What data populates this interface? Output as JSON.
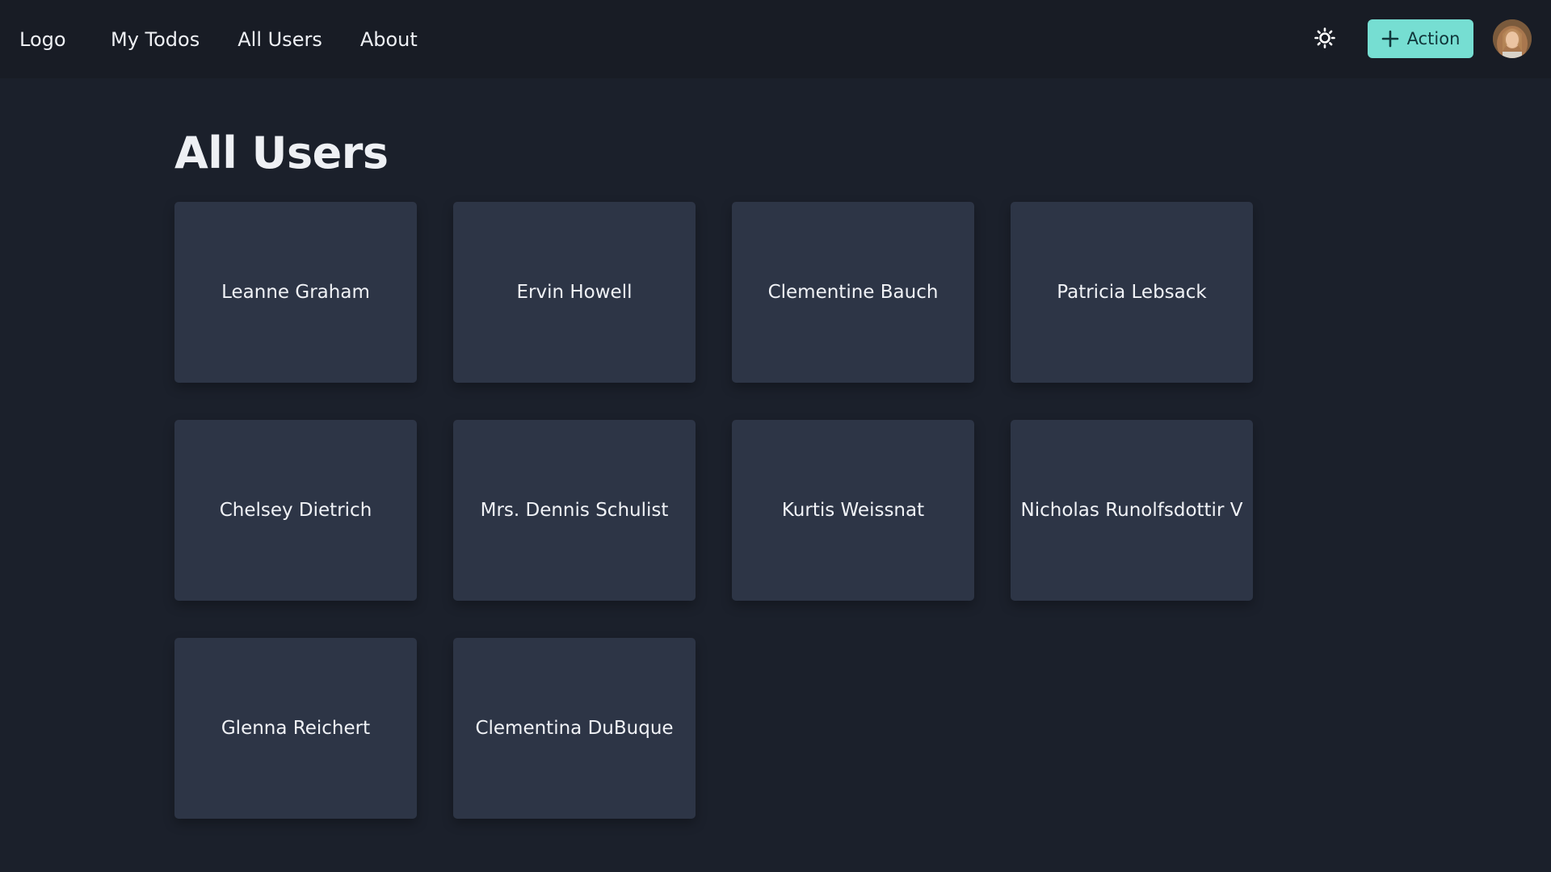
{
  "nav": {
    "logo": "Logo",
    "links": [
      {
        "label": "My Todos"
      },
      {
        "label": "All Users"
      },
      {
        "label": "About"
      }
    ],
    "theme_icon": "sun-icon",
    "action_label": "Action",
    "action_icon": "plus-icon",
    "avatar_icon": "user-avatar"
  },
  "page": {
    "title": "All Users"
  },
  "users": [
    {
      "name": "Leanne Graham"
    },
    {
      "name": "Ervin Howell"
    },
    {
      "name": "Clementine Bauch"
    },
    {
      "name": "Patricia Lebsack"
    },
    {
      "name": "Chelsey Dietrich"
    },
    {
      "name": "Mrs. Dennis Schulist"
    },
    {
      "name": "Kurtis Weissnat"
    },
    {
      "name": "Nicholas Runolfsdottir V"
    },
    {
      "name": "Glenna Reichert"
    },
    {
      "name": "Clementina DuBuque"
    }
  ],
  "colors": {
    "background": "#1b202b",
    "navbar": "#181c25",
    "card": "#2d3546",
    "accent": "#76ded2"
  }
}
